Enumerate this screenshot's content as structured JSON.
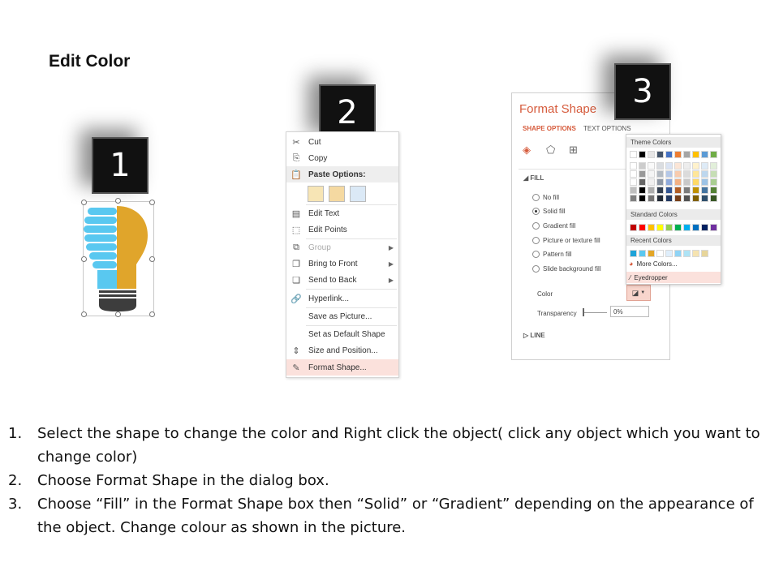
{
  "page_title": "Edit Color",
  "badges": [
    "1",
    "2",
    "3"
  ],
  "context_menu": {
    "items": [
      {
        "label": "Cut",
        "icon": "scissors-icon"
      },
      {
        "label": "Copy",
        "icon": "copy-icon"
      },
      {
        "label": "Paste Options:",
        "icon": "paste-icon"
      },
      {
        "label": "Edit Text",
        "icon": "edit-text-icon"
      },
      {
        "label": "Edit Points",
        "icon": "edit-points-icon"
      },
      {
        "label": "Group",
        "icon": "group-icon"
      },
      {
        "label": "Bring to Front",
        "icon": "bring-front-icon"
      },
      {
        "label": "Send to Back",
        "icon": "send-back-icon"
      },
      {
        "label": "Hyperlink...",
        "icon": "hyperlink-icon"
      },
      {
        "label": "Save as Picture...",
        "icon": ""
      },
      {
        "label": "Set as Default Shape",
        "icon": ""
      },
      {
        "label": "Size and Position...",
        "icon": "size-position-icon"
      },
      {
        "label": "Format Shape...",
        "icon": "format-shape-icon"
      }
    ]
  },
  "format_pane": {
    "title": "Format Shape",
    "tabs": [
      "SHAPE OPTIONS",
      "TEXT OPTIONS"
    ],
    "fill_section": "FILL",
    "fill_options": [
      "No fill",
      "Solid fill",
      "Gradient fill",
      "Picture or texture fill",
      "Pattern fill",
      "Slide background fill"
    ],
    "selected_fill": "Solid fill",
    "color_label": "Color",
    "transparency_label": "Transparency",
    "transparency_value": "0%",
    "line_section": "LINE"
  },
  "color_popup": {
    "theme_header": "Theme Colors",
    "standard_header": "Standard Colors",
    "recent_header": "Recent Colors",
    "more_colors": "More Colors...",
    "eyedropper": "Eyedropper",
    "theme_top": [
      "#ffffff",
      "#000000",
      "#e7e6e6",
      "#44546a",
      "#4472c4",
      "#ed7d31",
      "#a5a5a5",
      "#ffc000",
      "#5b9bd5",
      "#70ad47"
    ],
    "standard": [
      "#c00000",
      "#ff0000",
      "#ffc000",
      "#ffff00",
      "#92d050",
      "#00b050",
      "#00b0f0",
      "#0070c0",
      "#002060",
      "#7030a0"
    ],
    "recent": [
      "#1fa3d8",
      "#5bc8f0",
      "#e3a626",
      "#ffffff",
      "#dfeefb",
      "#8fd3f5",
      "#aee3f5",
      "#f6e3b0",
      "#e7d59a"
    ]
  },
  "bulb_colors": {
    "blue": "#59c8f0",
    "gold": "#e0a52b",
    "dark": "#3d3d3d"
  },
  "instructions": [
    {
      "num": "1.",
      "text": "Select the shape to change the color and Right click the object( click any object which you want to change color)"
    },
    {
      "num": "2.",
      "text": "Choose Format Shape in the dialog box."
    },
    {
      "num": "3.",
      "text": "Choose “Fill” in the Format Shape box then “Solid” or “Gradient” depending on the appearance of the object. Change colour as shown in the picture."
    }
  ]
}
